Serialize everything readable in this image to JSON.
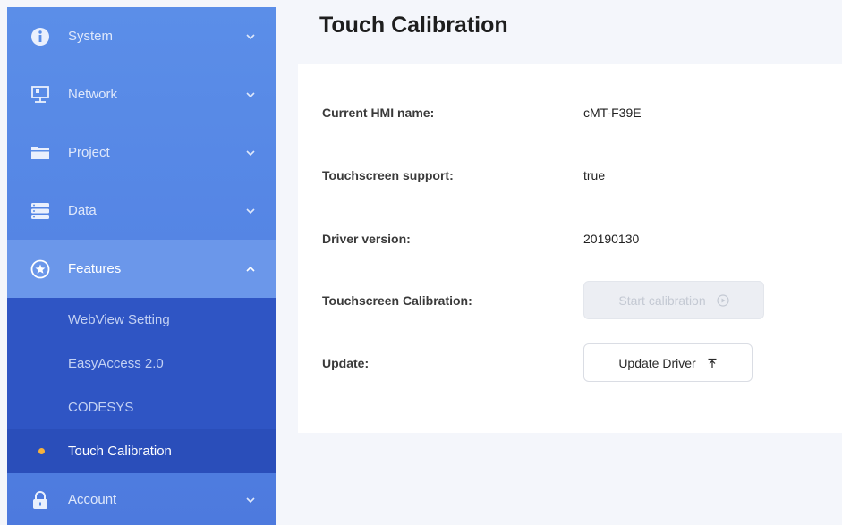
{
  "page_title": "Touch Calibration",
  "sidebar": {
    "items": [
      {
        "label": "System"
      },
      {
        "label": "Network"
      },
      {
        "label": "Project"
      },
      {
        "label": "Data"
      },
      {
        "label": "Features"
      },
      {
        "label": "Account"
      }
    ],
    "sub_items": [
      {
        "label": "WebView Setting"
      },
      {
        "label": "EasyAccess 2.0"
      },
      {
        "label": "CODESYS"
      },
      {
        "label": "Touch Calibration"
      }
    ]
  },
  "info": {
    "hmi_name_label": "Current HMI name:",
    "hmi_name_value": "cMT-F39E",
    "touch_support_label": "Touchscreen support:",
    "touch_support_value": "true",
    "driver_version_label": "Driver version:",
    "driver_version_value": "20190130",
    "calibration_label": "Touchscreen Calibration:",
    "calibration_button": "Start calibration",
    "update_label": "Update:",
    "update_button": "Update Driver"
  },
  "colors": {
    "sidebar": "#5484e4",
    "submenu": "#2f55c4",
    "active_dot": "#f6b23c"
  }
}
